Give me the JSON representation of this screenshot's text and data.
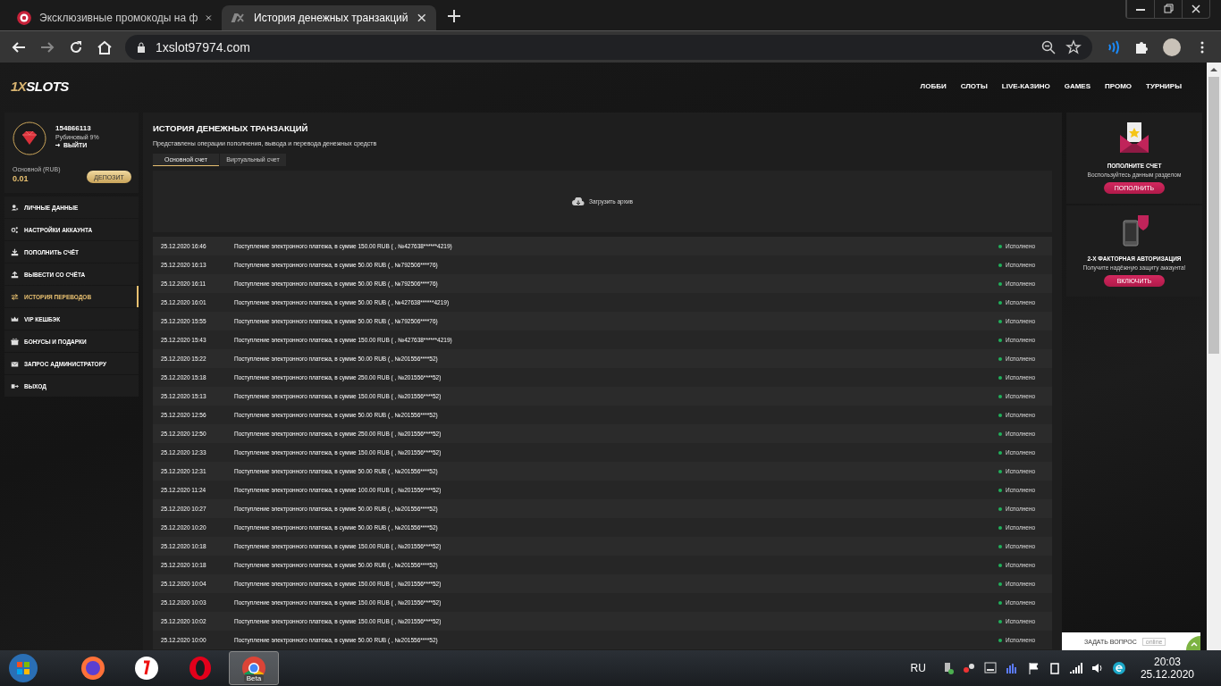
{
  "browser": {
    "tabs": [
      {
        "title": "Эксклюзивные промокоды на ф",
        "selected": false
      },
      {
        "title": "История денежных транзакций",
        "selected": true
      }
    ],
    "address": "1xslot97974.com"
  },
  "site": {
    "logo_prefix": "1X",
    "logo_name": "SLOTS",
    "nav": [
      "ЛОББИ",
      "СЛОТЫ",
      "LIVE-КАЗИНО",
      "GAMES",
      "ПРОМО",
      "ТУРНИРЫ"
    ]
  },
  "profile": {
    "id": "154866113",
    "level": "Рубиновый 9%",
    "logout": "ВЫЙТИ",
    "balance_label": "Основной (RUB)",
    "balance": "0.01",
    "deposit_button": "ДЕПОЗИТ"
  },
  "menu": [
    {
      "label": "ЛИЧНЫЕ ДАННЫЕ",
      "selected": false
    },
    {
      "label": "НАСТРОЙКИ АККАУНТА",
      "selected": false
    },
    {
      "label": "ПОПОЛНИТЬ СЧЁТ",
      "selected": false
    },
    {
      "label": "ВЫВЕСТИ СО СЧЁТА",
      "selected": false
    },
    {
      "label": "ИСТОРИЯ ПЕРЕВОДОВ",
      "selected": true
    },
    {
      "label": "VIP КЕШБЭК",
      "selected": false
    },
    {
      "label": "БОНУСЫ И ПОДАРКИ",
      "selected": false
    },
    {
      "label": "ЗАПРОС АДМИНИСТРАТОРУ",
      "selected": false
    },
    {
      "label": "ВЫХОД",
      "selected": false
    }
  ],
  "main": {
    "title": "ИСТОРИЯ ДЕНЕЖНЫХ ТРАНЗАКЦИЙ",
    "subtitle": "Представлены операции пополнения, вывода и перевода денежных средств",
    "tabs": [
      {
        "label": "Основной счет",
        "selected": true
      },
      {
        "label": "Виртуальный счет",
        "selected": false
      }
    ],
    "archive_button": "Загрузить архив",
    "transactions": [
      {
        "date": "25.12.2020 16:46",
        "description": "Поступление электронного платежа, в сумме 150.00 RUB ( , №427638******4219)",
        "status": "Исполнено"
      },
      {
        "date": "25.12.2020 16:13",
        "description": "Поступление электронного платежа, в сумме 50.00 RUB ( , №792506****76)",
        "status": "Исполнено"
      },
      {
        "date": "25.12.2020 16:11",
        "description": "Поступление электронного платежа, в сумме 50.00 RUB ( , №792506****76)",
        "status": "Исполнено"
      },
      {
        "date": "25.12.2020 16:01",
        "description": "Поступление электронного платежа, в сумме 50.00 RUB ( , №427638******4219)",
        "status": "Исполнено"
      },
      {
        "date": "25.12.2020 15:55",
        "description": "Поступление электронного платежа, в сумме 50.00 RUB ( , №792506****76)",
        "status": "Исполнено"
      },
      {
        "date": "25.12.2020 15:43",
        "description": "Поступление электронного платежа, в сумме 150.00 RUB ( , №427638******4219)",
        "status": "Исполнено"
      },
      {
        "date": "25.12.2020 15:22",
        "description": "Поступление электронного платежа, в сумме 50.00 RUB ( , №201556****52)",
        "status": "Исполнено"
      },
      {
        "date": "25.12.2020 15:18",
        "description": "Поступление электронного платежа, в сумме 250.00 RUB ( , №201556****52)",
        "status": "Исполнено"
      },
      {
        "date": "25.12.2020 15:13",
        "description": "Поступление электронного платежа, в сумме 150.00 RUB ( , №201556****52)",
        "status": "Исполнено"
      },
      {
        "date": "25.12.2020 12:56",
        "description": "Поступление электронного платежа, в сумме 50.00 RUB ( , №201556****52)",
        "status": "Исполнено"
      },
      {
        "date": "25.12.2020 12:50",
        "description": "Поступление электронного платежа, в сумме 250.00 RUB ( , №201556****52)",
        "status": "Исполнено"
      },
      {
        "date": "25.12.2020 12:33",
        "description": "Поступление электронного платежа, в сумме 150.00 RUB ( , №201556****52)",
        "status": "Исполнено"
      },
      {
        "date": "25.12.2020 12:31",
        "description": "Поступление электронного платежа, в сумме 50.00 RUB ( , №201556****52)",
        "status": "Исполнено"
      },
      {
        "date": "25.12.2020 11:24",
        "description": "Поступление электронного платежа, в сумме 100.00 RUB ( , №201556****52)",
        "status": "Исполнено"
      },
      {
        "date": "25.12.2020 10:27",
        "description": "Поступление электронного платежа, в сумме 50.00 RUB ( , №201556****52)",
        "status": "Исполнено"
      },
      {
        "date": "25.12.2020 10:20",
        "description": "Поступление электронного платежа, в сумме 50.00 RUB ( , №201556****52)",
        "status": "Исполнено"
      },
      {
        "date": "25.12.2020 10:18",
        "description": "Поступление электронного платежа, в сумме 150.00 RUB ( , №201556****52)",
        "status": "Исполнено"
      },
      {
        "date": "25.12.2020 10:18",
        "description": "Поступление электронного платежа, в сумме 50.00 RUB ( , №201556****52)",
        "status": "Исполнено"
      },
      {
        "date": "25.12.2020 10:04",
        "description": "Поступление электронного платежа, в сумме 150.00 RUB ( , №201556****52)",
        "status": "Исполнено"
      },
      {
        "date": "25.12.2020 10:03",
        "description": "Поступление электронного платежа, в сумме 150.00 RUB ( , №201556****52)",
        "status": "Исполнено"
      },
      {
        "date": "25.12.2020 10:02",
        "description": "Поступление электронного платежа, в сумме 150.00 RUB ( , №201556****52)",
        "status": "Исполнено"
      },
      {
        "date": "25.12.2020 10:00",
        "description": "Поступление электронного платежа, в сумме 50.00 RUB ( , №201556****52)",
        "status": "Исполнено"
      }
    ]
  },
  "promo_cards": [
    {
      "title": "ПОПОЛНИТЕ СЧЕТ",
      "text": "Воспользуйтесь данным разделом",
      "button": "ПОПОЛНИТЬ"
    },
    {
      "title": "2-Х ФАКТОРНАЯ АВТОРИЗАЦИЯ",
      "text": "Получите надёжную защиту аккаунта!",
      "button": "ВКЛЮЧИТЬ"
    }
  ],
  "chat": {
    "label": "ЗАДАТЬ ВОПРОС",
    "badge": "online"
  },
  "taskbar": {
    "apps": [
      {
        "selected": false
      },
      {
        "selected": false
      },
      {
        "selected": false
      },
      {
        "selected": true,
        "badge": "Beta"
      }
    ],
    "language": "RU",
    "time": "20:03",
    "date": "25.12.2020"
  }
}
